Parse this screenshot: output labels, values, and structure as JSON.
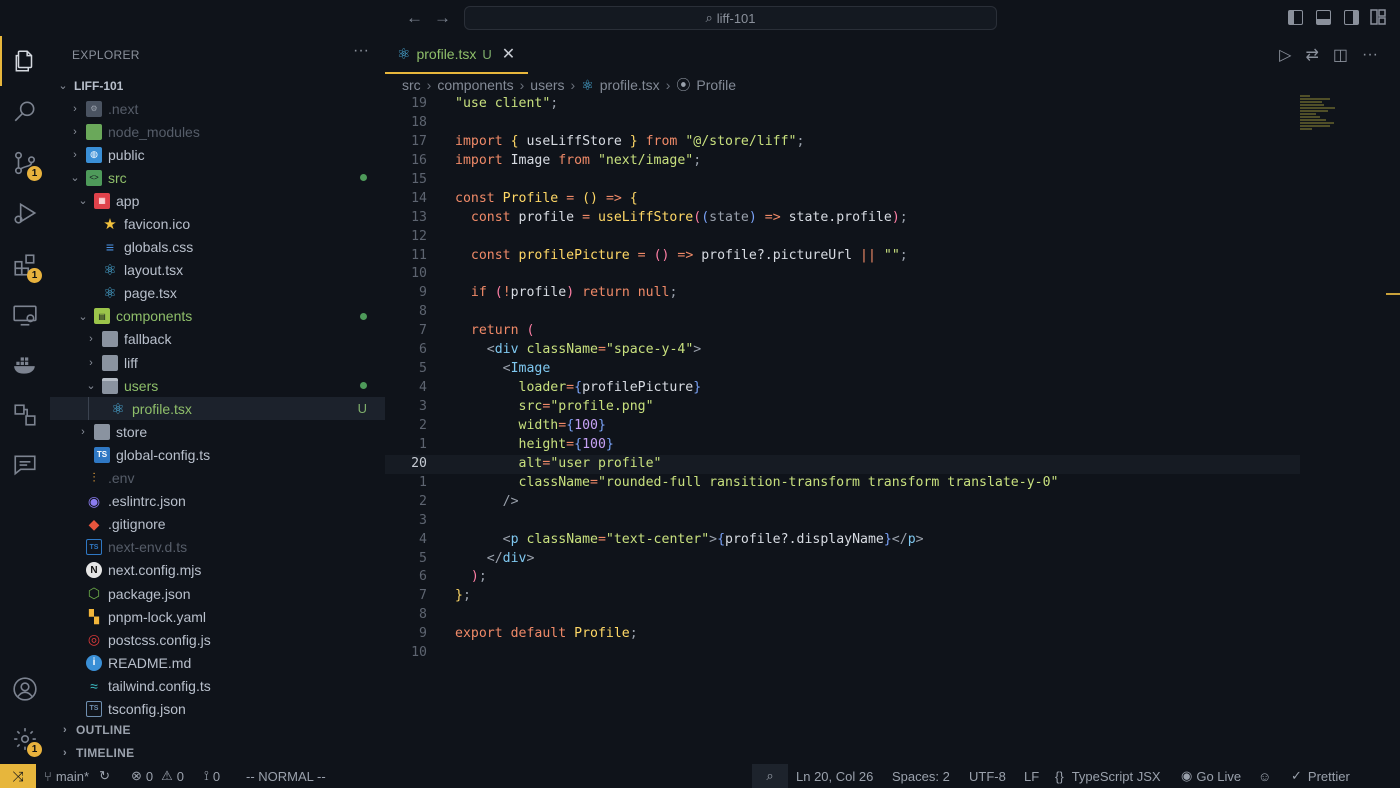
{
  "titlebar": {
    "search": "liff-101"
  },
  "sidebar": {
    "title": "EXPLORER",
    "root": "LIFF-101",
    "items": [
      {
        "label": ".next"
      },
      {
        "label": "node_modules"
      },
      {
        "label": "public"
      },
      {
        "label": "src"
      },
      {
        "label": "app"
      },
      {
        "label": "favicon.ico"
      },
      {
        "label": "globals.css"
      },
      {
        "label": "layout.tsx"
      },
      {
        "label": "page.tsx"
      },
      {
        "label": "components"
      },
      {
        "label": "fallback"
      },
      {
        "label": "liff"
      },
      {
        "label": "users"
      },
      {
        "label": "profile.tsx",
        "git": "U"
      },
      {
        "label": "store"
      },
      {
        "label": "global-config.ts"
      },
      {
        "label": ".env"
      },
      {
        "label": ".eslintrc.json"
      },
      {
        "label": ".gitignore"
      },
      {
        "label": "next-env.d.ts"
      },
      {
        "label": "next.config.mjs"
      },
      {
        "label": "package.json"
      },
      {
        "label": "pnpm-lock.yaml"
      },
      {
        "label": "postcss.config.js"
      },
      {
        "label": "README.md"
      },
      {
        "label": "tailwind.config.ts"
      },
      {
        "label": "tsconfig.json"
      }
    ],
    "outline": "OUTLINE",
    "timeline": "TIMELINE"
  },
  "activity": {
    "scm_badge": "1",
    "ext_badge": "1",
    "settings_badge": "1"
  },
  "tab": {
    "label": "profile.tsx",
    "status": "U",
    "close": "✕"
  },
  "breadcrumb": [
    "src",
    "components",
    "users",
    "profile.tsx",
    "Profile"
  ],
  "code": {
    "line_numbers": [
      "19",
      "18",
      "17",
      "16",
      "15",
      "14",
      "13",
      "12",
      "11",
      "10",
      "9",
      "8",
      "7",
      "6",
      "5",
      "4",
      "3",
      "2",
      "1",
      "20",
      "1",
      "2",
      "3",
      "4",
      "5",
      "6",
      "7",
      "8",
      "9",
      "10"
    ]
  },
  "status": {
    "branch": "main*",
    "errors": "0",
    "warnings": "0",
    "ports": "0",
    "mode": "-- NORMAL --",
    "position": "Ln 20, Col 26",
    "spaces": "Spaces: 2",
    "encoding": "UTF-8",
    "eol": "LF",
    "language": "TypeScript JSX",
    "golive": "Go Live",
    "prettier": "Prettier"
  }
}
